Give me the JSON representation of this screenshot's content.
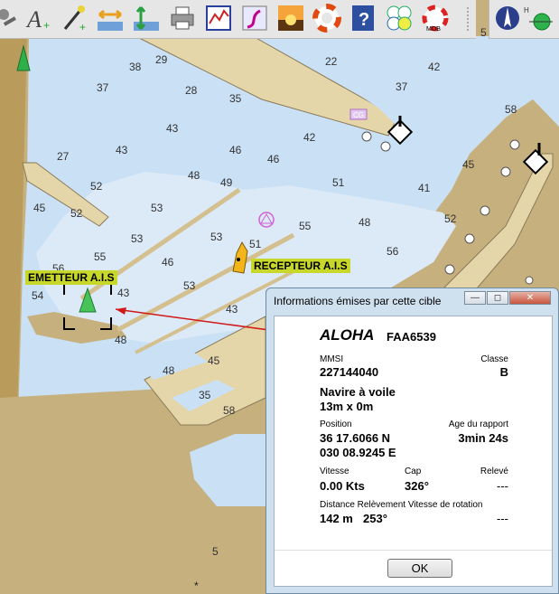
{
  "toolbar": {
    "buttons": [
      {
        "name": "settings-tool-icon"
      },
      {
        "name": "text-tool-icon"
      },
      {
        "name": "route-tool-icon"
      },
      {
        "name": "width-tool-icon"
      },
      {
        "name": "height-tool-icon"
      },
      {
        "name": "print-icon"
      },
      {
        "name": "chart-graph-icon"
      },
      {
        "name": "track-icon"
      },
      {
        "name": "sunset-icon"
      },
      {
        "name": "lifebuoy-icon"
      },
      {
        "name": "help-icon"
      },
      {
        "name": "instruments-icon"
      },
      {
        "name": "mob-icon"
      }
    ]
  },
  "map": {
    "soundings": [
      {
        "v": "29"
      },
      {
        "v": "38"
      },
      {
        "v": "37"
      },
      {
        "v": "28"
      },
      {
        "v": "35"
      },
      {
        "v": "22"
      },
      {
        "v": "42"
      },
      {
        "v": "37"
      },
      {
        "v": "58"
      },
      {
        "v": "43"
      },
      {
        "v": "42"
      },
      {
        "v": "43"
      },
      {
        "v": "46"
      },
      {
        "v": "46"
      },
      {
        "v": "27"
      },
      {
        "v": "48"
      },
      {
        "v": "49"
      },
      {
        "v": "51"
      },
      {
        "v": "45"
      },
      {
        "v": "52"
      },
      {
        "v": "41"
      },
      {
        "v": "45"
      },
      {
        "v": "52"
      },
      {
        "v": "53"
      },
      {
        "v": "48"
      },
      {
        "v": "52"
      },
      {
        "v": "55"
      },
      {
        "v": "53"
      },
      {
        "v": "53"
      },
      {
        "v": "51"
      },
      {
        "v": "56"
      },
      {
        "v": "55"
      },
      {
        "v": "46"
      },
      {
        "v": "56"
      },
      {
        "v": "53"
      },
      {
        "v": "43"
      },
      {
        "v": "54"
      },
      {
        "v": "43"
      },
      {
        "v": "48"
      },
      {
        "v": "48"
      },
      {
        "v": "45"
      },
      {
        "v": "35"
      },
      {
        "v": "58"
      },
      {
        "v": "5"
      },
      {
        "v": "CG"
      }
    ],
    "emitter_label": "EMETTEUR  A.I.S",
    "receiver_label": "RECEPTEUR  A.I.S",
    "colors": {
      "land": "#c6b07e",
      "sea": "#c9e0f5",
      "deep": "#dce9f7",
      "lightland": "#e5d6a9"
    }
  },
  "dialog": {
    "title": "Informations émises par cette cible",
    "min": "—",
    "restore": "◻",
    "close": "✕",
    "name": "ALOHA",
    "callsign": "FAA6539",
    "mmsi_label": "MMSI",
    "mmsi": "227144040",
    "class_label": "Classe",
    "class": "B",
    "type": "Navire à voile",
    "dimensions": "13m x 0m",
    "position_label": "Position",
    "lat": "36 17.6066 N",
    "lon": "030 08.9245 E",
    "age_label": "Age du rapport",
    "age": "3min 24s",
    "speed_label": "Vitesse",
    "speed": "0.00 Kts",
    "heading_label": "Cap",
    "heading": "326°",
    "bearing_label": "Relevé",
    "bearing": "---",
    "dist_label": "Distance Relèvement Vitesse de rotation",
    "dist": "142 m",
    "bearing2": "253°",
    "rot": "---",
    "ok": "OK"
  }
}
